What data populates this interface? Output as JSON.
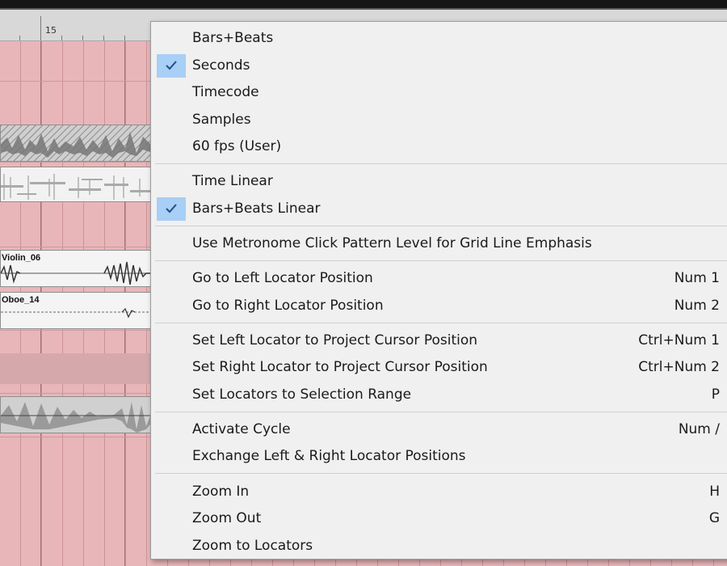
{
  "ruler": {
    "bar_number": "15"
  },
  "events": [
    {
      "name": "Violin_06"
    },
    {
      "name": "Oboe_14"
    }
  ],
  "context_menu": {
    "items": [
      {
        "label": "Bars+Beats",
        "shortcut": "",
        "checked": false
      },
      {
        "label": "Seconds",
        "shortcut": "",
        "checked": true
      },
      {
        "label": "Timecode",
        "shortcut": "",
        "checked": false
      },
      {
        "label": "Samples",
        "shortcut": "",
        "checked": false
      },
      {
        "label": "60 fps (User)",
        "shortcut": "",
        "checked": false
      },
      {
        "label": "Time Linear",
        "shortcut": "",
        "checked": false
      },
      {
        "label": "Bars+Beats Linear",
        "shortcut": "",
        "checked": true
      },
      {
        "label": "Use Metronome Click Pattern Level for Grid Line Emphasis",
        "shortcut": "",
        "checked": false
      },
      {
        "label": "Go to Left Locator Position",
        "shortcut": "Num 1",
        "checked": false
      },
      {
        "label": "Go to Right Locator Position",
        "shortcut": "Num 2",
        "checked": false
      },
      {
        "label": "Set Left Locator to Project Cursor Position",
        "shortcut": "Ctrl+Num 1",
        "checked": false
      },
      {
        "label": "Set Right Locator to Project Cursor Position",
        "shortcut": "Ctrl+Num 2",
        "checked": false
      },
      {
        "label": "Set Locators to Selection Range",
        "shortcut": "P",
        "checked": false
      },
      {
        "label": "Activate Cycle",
        "shortcut": "Num /",
        "checked": false
      },
      {
        "label": "Exchange Left & Right Locator Positions",
        "shortcut": "",
        "checked": false
      },
      {
        "label": "Zoom In",
        "shortcut": "H",
        "checked": false
      },
      {
        "label": "Zoom Out",
        "shortcut": "G",
        "checked": false
      },
      {
        "label": "Zoom to Locators",
        "shortcut": "",
        "checked": false
      }
    ]
  },
  "colors": {
    "arrange_background": "#e8b6b9",
    "menu_background": "#f0f0f0",
    "check_highlight": "#a8cff5",
    "check_mark": "#1f4f86"
  },
  "icons": {
    "check": "checkmark-icon"
  }
}
